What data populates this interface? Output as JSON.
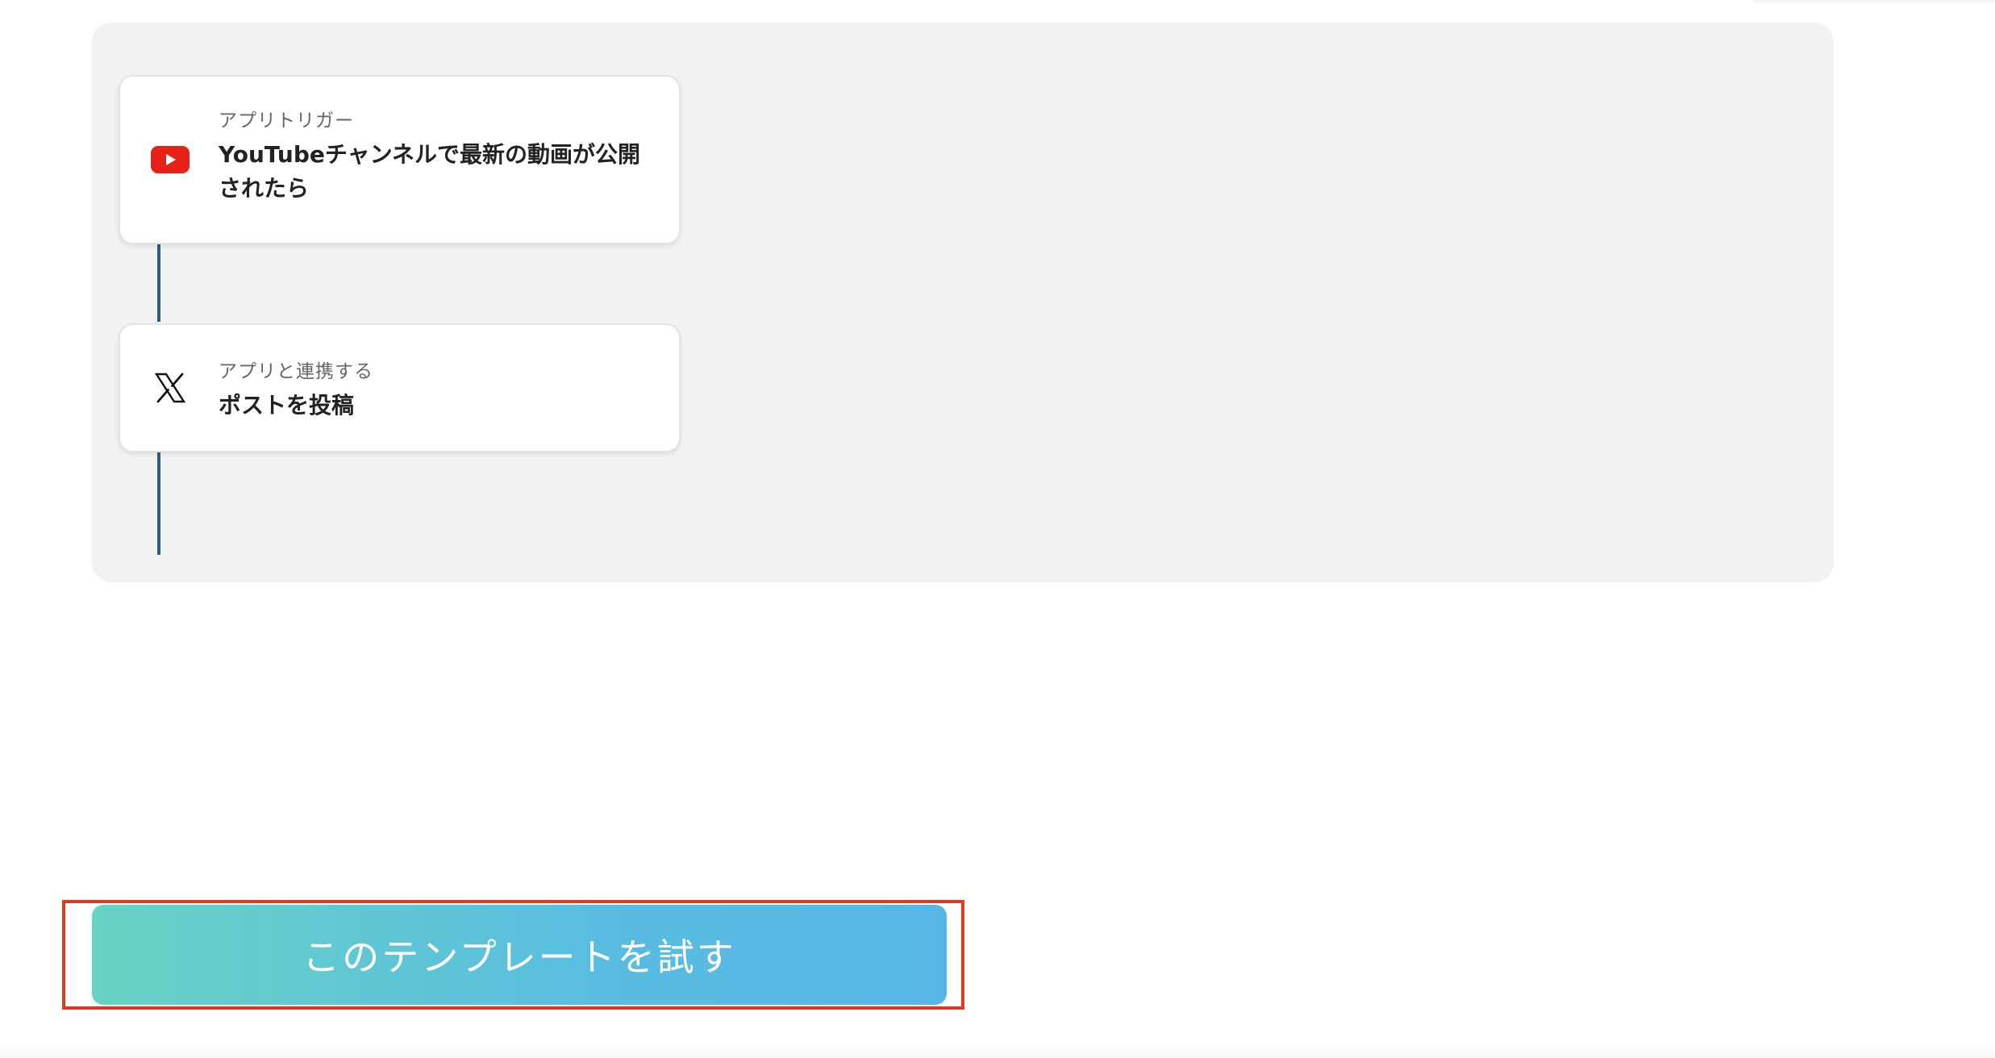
{
  "flow": {
    "steps": [
      {
        "kind": "アプリトリガー",
        "title": "YouTubeチャンネルで最新の動画が公開されたら",
        "icon": "youtube-icon"
      },
      {
        "kind": "アプリと連携する",
        "title": "ポストを投稿",
        "icon": "x-icon"
      }
    ]
  },
  "cta": {
    "label": "このテンプレートを試す"
  },
  "colors": {
    "panel_bg": "#f2f2f2",
    "connector": "#2f5f7f",
    "youtube_red": "#e62117",
    "cta_gradient_start": "#67d3c4",
    "cta_gradient_end": "#57b6e5",
    "highlight_border": "#e13a1f"
  }
}
